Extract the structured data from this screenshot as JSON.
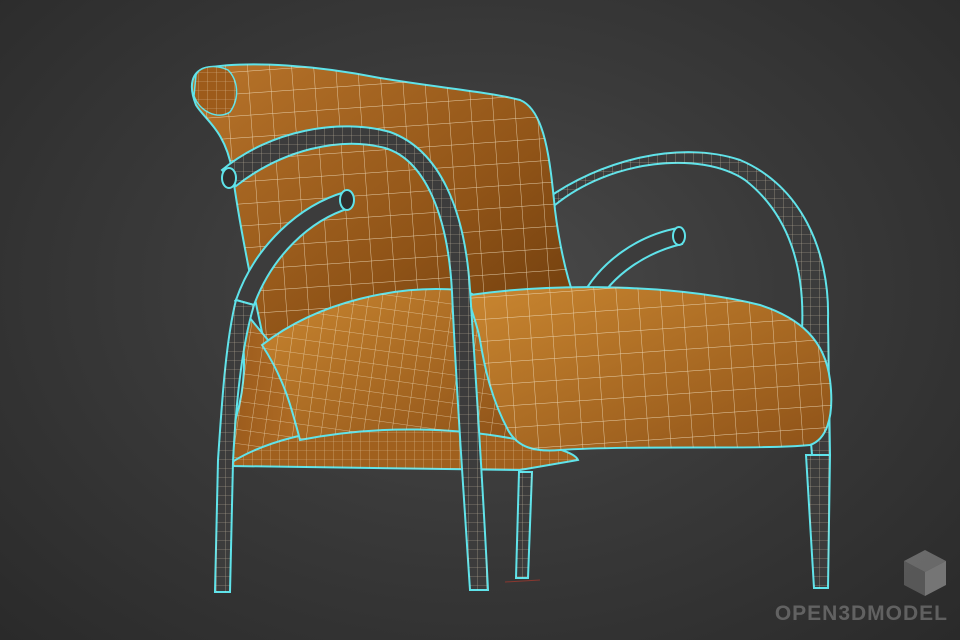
{
  "scene": {
    "subject": "armchair-wireframe",
    "colors": {
      "background": "#3a3a3a",
      "upholstery": "#a2621c",
      "upholstery_light": "#c8832e",
      "upholstery_dark": "#6e3d0c",
      "wire": "#f2e2c2",
      "outline": "#5fe3ea",
      "frame": "#3c3c3c"
    }
  },
  "watermark": {
    "text": "OPEN3DMODEL",
    "logo": "cube-logo-icon"
  }
}
